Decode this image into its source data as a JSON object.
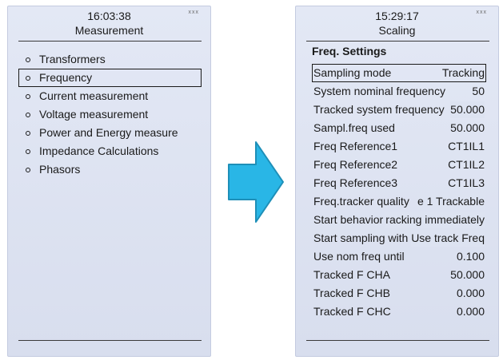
{
  "left_screen": {
    "time": "16:03:38",
    "title": "Measurement",
    "status": "xxx",
    "menu": [
      {
        "label": "Transformers"
      },
      {
        "label": "Frequency"
      },
      {
        "label": "Current measurement"
      },
      {
        "label": "Voltage measurement"
      },
      {
        "label": "Power and Energy measure"
      },
      {
        "label": "Impedance Calculations"
      },
      {
        "label": "Phasors"
      }
    ],
    "selected_index": 1
  },
  "arrow": {
    "icon": "right-arrow-icon",
    "color": "#29b6e6",
    "outline": "#1e8fb8"
  },
  "right_screen": {
    "time": "15:29:17",
    "title": "Scaling",
    "status": "xxx",
    "section_title": "Freq. Settings",
    "rows": [
      {
        "label": "Sampling mode",
        "value": "Tracking"
      },
      {
        "label": "System nominal frequency",
        "value": "50"
      },
      {
        "label": "Tracked system frequency",
        "value": "50.000"
      },
      {
        "label": "Sampl.freq used",
        "value": "50.000"
      },
      {
        "label": "Freq Reference1",
        "value": "CT1IL1"
      },
      {
        "label": "Freq Reference2",
        "value": "CT1IL2"
      },
      {
        "label": "Freq Reference3",
        "value": "CT1IL3"
      },
      {
        "label": "Freq.tracker quality",
        "value": "e 1 Trackable"
      },
      {
        "label": "Start behavior",
        "value": "racking immediately"
      },
      {
        "label": "Start sampling with",
        "value": "Use track Freq"
      },
      {
        "label": "Use nom freq until",
        "value": "0.100"
      },
      {
        "label": "Tracked F CHA",
        "value": "50.000"
      },
      {
        "label": "Tracked F CHB",
        "value": "0.000"
      },
      {
        "label": "Tracked F CHC",
        "value": "0.000"
      }
    ],
    "selected_index": 0
  }
}
